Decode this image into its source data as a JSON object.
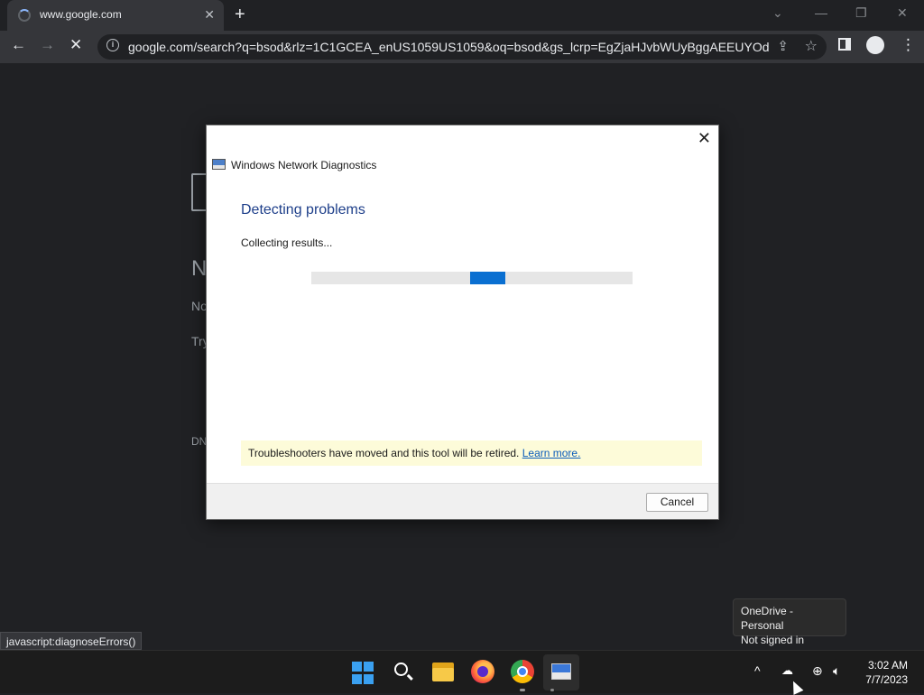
{
  "browser": {
    "tab_title": "www.google.com",
    "tab_close": "✕",
    "new_tab": "+",
    "url": "google.com/search?q=bsod&rlz=1C1GCEA_enUS1059US1059&oq=bsod&gs_lcrp=EgZjaHJvbWUyBggAEEUYOdI...",
    "status_link": "javascript:diagnoseErrors()"
  },
  "background_page": {
    "heading_fragment": "N",
    "line1_fragment": "No",
    "line2_fragment": "Try",
    "footer_fragment": "DN"
  },
  "dialog": {
    "app_title": "Windows Network Diagnostics",
    "heading": "Detecting problems",
    "status": "Collecting results...",
    "progress_fraction": 0.55,
    "notice_text": "Troubleshooters have moved and this tool will be retired.",
    "notice_link": "Learn more.",
    "cancel_label": "Cancel",
    "accent_color": "#0a6fd1"
  },
  "tooltip": {
    "line1": "OneDrive - Personal",
    "line2": "Not signed in"
  },
  "taskbar": {
    "time": "3:02 AM",
    "date": "7/7/2023"
  }
}
